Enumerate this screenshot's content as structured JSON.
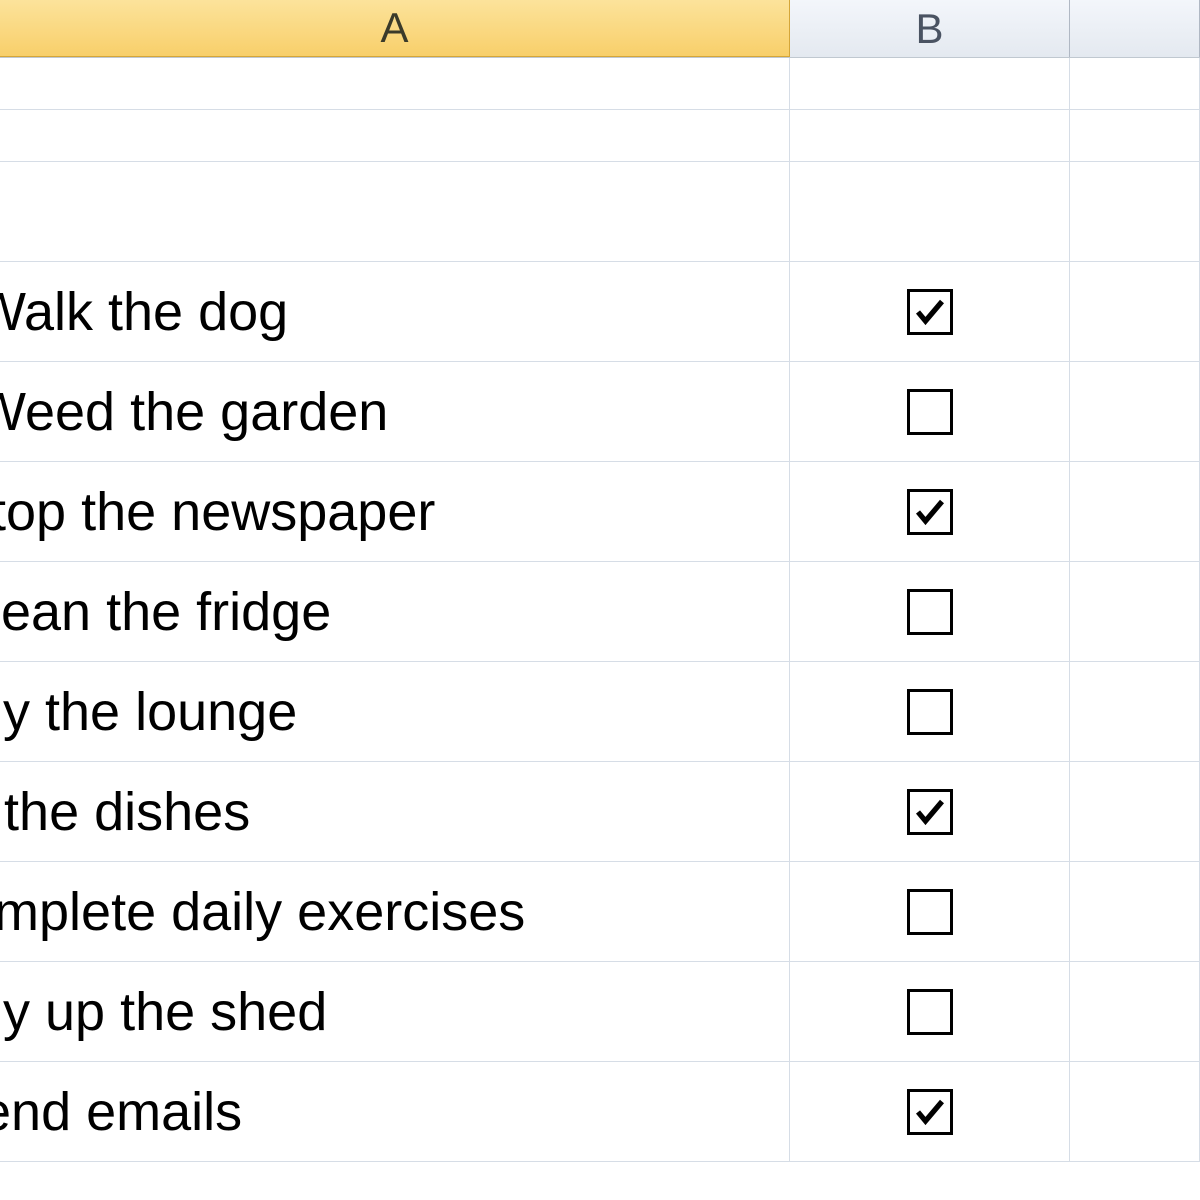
{
  "columns": {
    "A": "A",
    "B": "B",
    "C": ""
  },
  "items": [
    {
      "label": "Walk the dog",
      "checked": true
    },
    {
      "label": "Weed the garden",
      "checked": false
    },
    {
      "label": "Stop the newspaper",
      "checked": true
    },
    {
      "label": "Clean the fridge",
      "checked": false
    },
    {
      "label": "Tidy the lounge",
      "checked": false
    },
    {
      "label": "Do the dishes",
      "checked": true
    },
    {
      "label": "Complete daily exercises",
      "checked": false
    },
    {
      "label": "Tidy up the shed",
      "checked": false
    },
    {
      "label": "Send emails",
      "checked": true
    }
  ],
  "clip_offsets": [
    25,
    25,
    45,
    50,
    70,
    80,
    75,
    70,
    55
  ]
}
